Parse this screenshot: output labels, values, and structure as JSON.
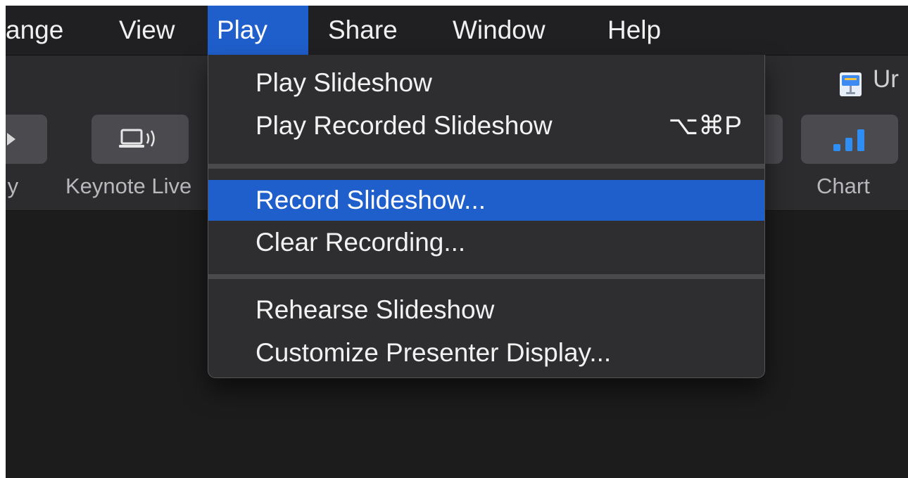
{
  "menubar": {
    "items": [
      {
        "label": "ange"
      },
      {
        "label": "View"
      },
      {
        "label": "Play"
      },
      {
        "label": "Share"
      },
      {
        "label": "Window"
      },
      {
        "label": "Help"
      }
    ]
  },
  "toolbar": {
    "document_title": "Ur",
    "buttons": [
      {
        "label": "ıy",
        "icon": "play-icon"
      },
      {
        "label": "Keynote Live",
        "icon": "keynote-live-icon"
      },
      {
        "label": "",
        "icon": ""
      },
      {
        "label": "Chart",
        "icon": "chart-icon"
      }
    ]
  },
  "play_menu": {
    "items": [
      {
        "label": "Play Slideshow",
        "shortcut": ""
      },
      {
        "label": "Play Recorded Slideshow",
        "shortcut": "⌥⌘P"
      },
      {
        "label": "Record Slideshow...",
        "shortcut": "",
        "highlighted": true
      },
      {
        "label": "Clear Recording...",
        "shortcut": ""
      },
      {
        "label": "Rehearse Slideshow",
        "shortcut": ""
      },
      {
        "label": "Customize Presenter Display...",
        "shortcut": ""
      }
    ]
  },
  "colors": {
    "highlight": "#1f5fcc",
    "menu_bg": "#2e2e30",
    "chart_icon": "#2f8ef4"
  }
}
